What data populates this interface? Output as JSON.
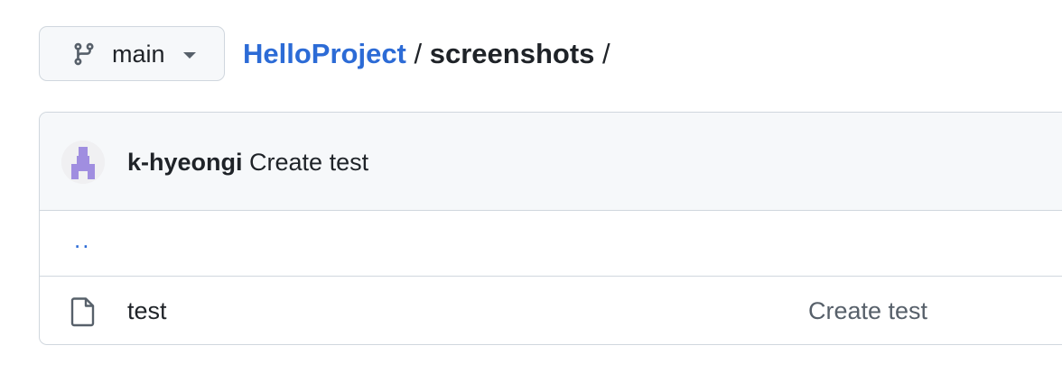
{
  "branch": {
    "name": "main",
    "icon": "git-branch-icon"
  },
  "breadcrumb": {
    "repo": "HelloProject",
    "separator": "/",
    "folder": "screenshots",
    "trailing": "/"
  },
  "latest_commit": {
    "author": "k-hyeongi",
    "message": "Create test",
    "avatar_color": "#a08ee0"
  },
  "listing": {
    "parent_link": "..",
    "files": [
      {
        "name": "test",
        "icon": "file-icon",
        "commit_message": "Create test"
      }
    ]
  },
  "colors": {
    "link": "#2c6bd6",
    "border": "#d0d7de",
    "header_bg": "#f6f8fa",
    "muted_text": "#57606a"
  }
}
